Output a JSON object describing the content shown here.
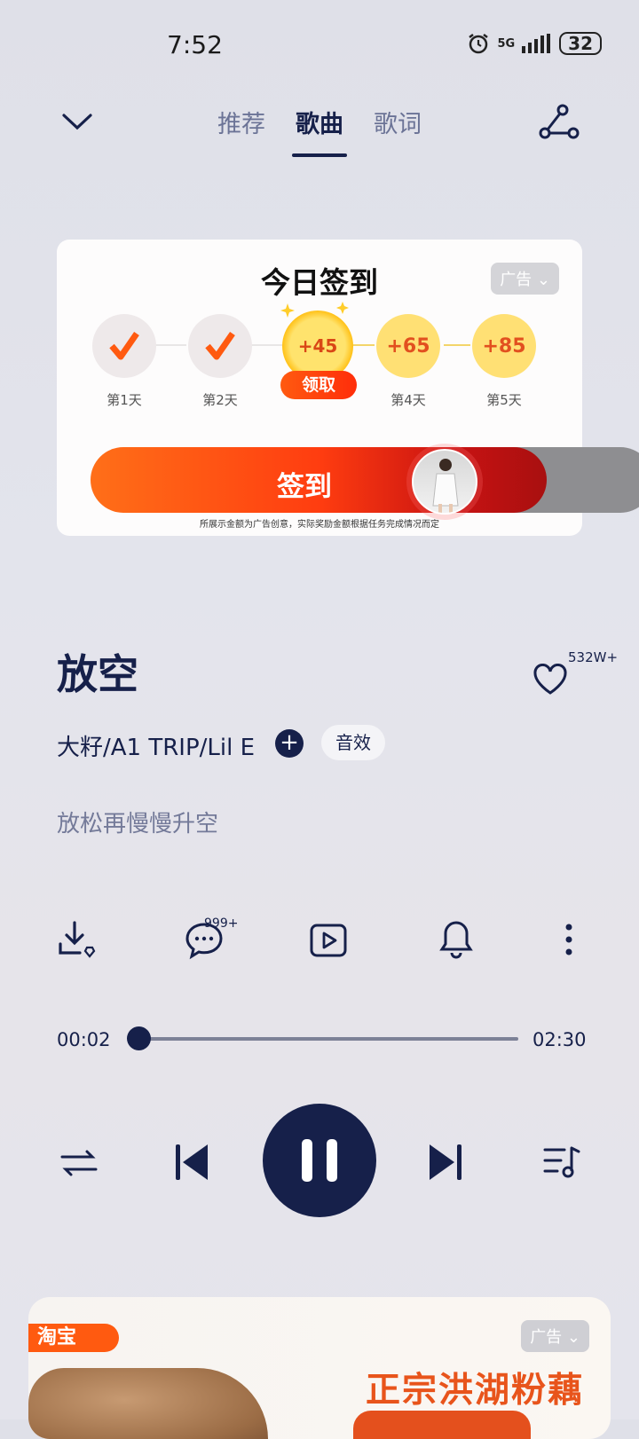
{
  "status_bar": {
    "time": "7:52",
    "network": "5G",
    "battery": "32"
  },
  "nav": {
    "tabs": [
      {
        "label": "推荐"
      },
      {
        "label": "歌曲",
        "active": true
      },
      {
        "label": "歌词"
      }
    ]
  },
  "checkin_ad": {
    "title": "今日签到",
    "ad_label": "广告",
    "days": [
      {
        "label": "第1天",
        "state": "done"
      },
      {
        "label": "第2天",
        "state": "done"
      },
      {
        "value": "+45",
        "state": "today"
      },
      {
        "label": "第4天",
        "value": "+65",
        "state": "upcoming"
      },
      {
        "label": "第5天",
        "value": "+85",
        "state": "upcoming"
      }
    ],
    "claim_label": "领取",
    "sign_button": "签到",
    "disclaimer": "所展示金额为广告创意，实际奖励金额根据任务完成情况而定"
  },
  "song": {
    "title": "放空",
    "likes": "532W+",
    "artist": "大籽/A1 TRIP/Lil E",
    "effect_chip": "音效",
    "lyric": "放松再慢慢升空",
    "comment_count": "999+"
  },
  "player": {
    "current_time": "00:02",
    "total_time": "02:30",
    "progress": 0.013
  },
  "bottom_ad": {
    "brand": "淘宝",
    "ad_label": "广告",
    "headline": "正宗洪湖粉藕"
  },
  "colors": {
    "accent": "#16204a",
    "orange": "#ff5a10",
    "coin": "#ffe074"
  }
}
